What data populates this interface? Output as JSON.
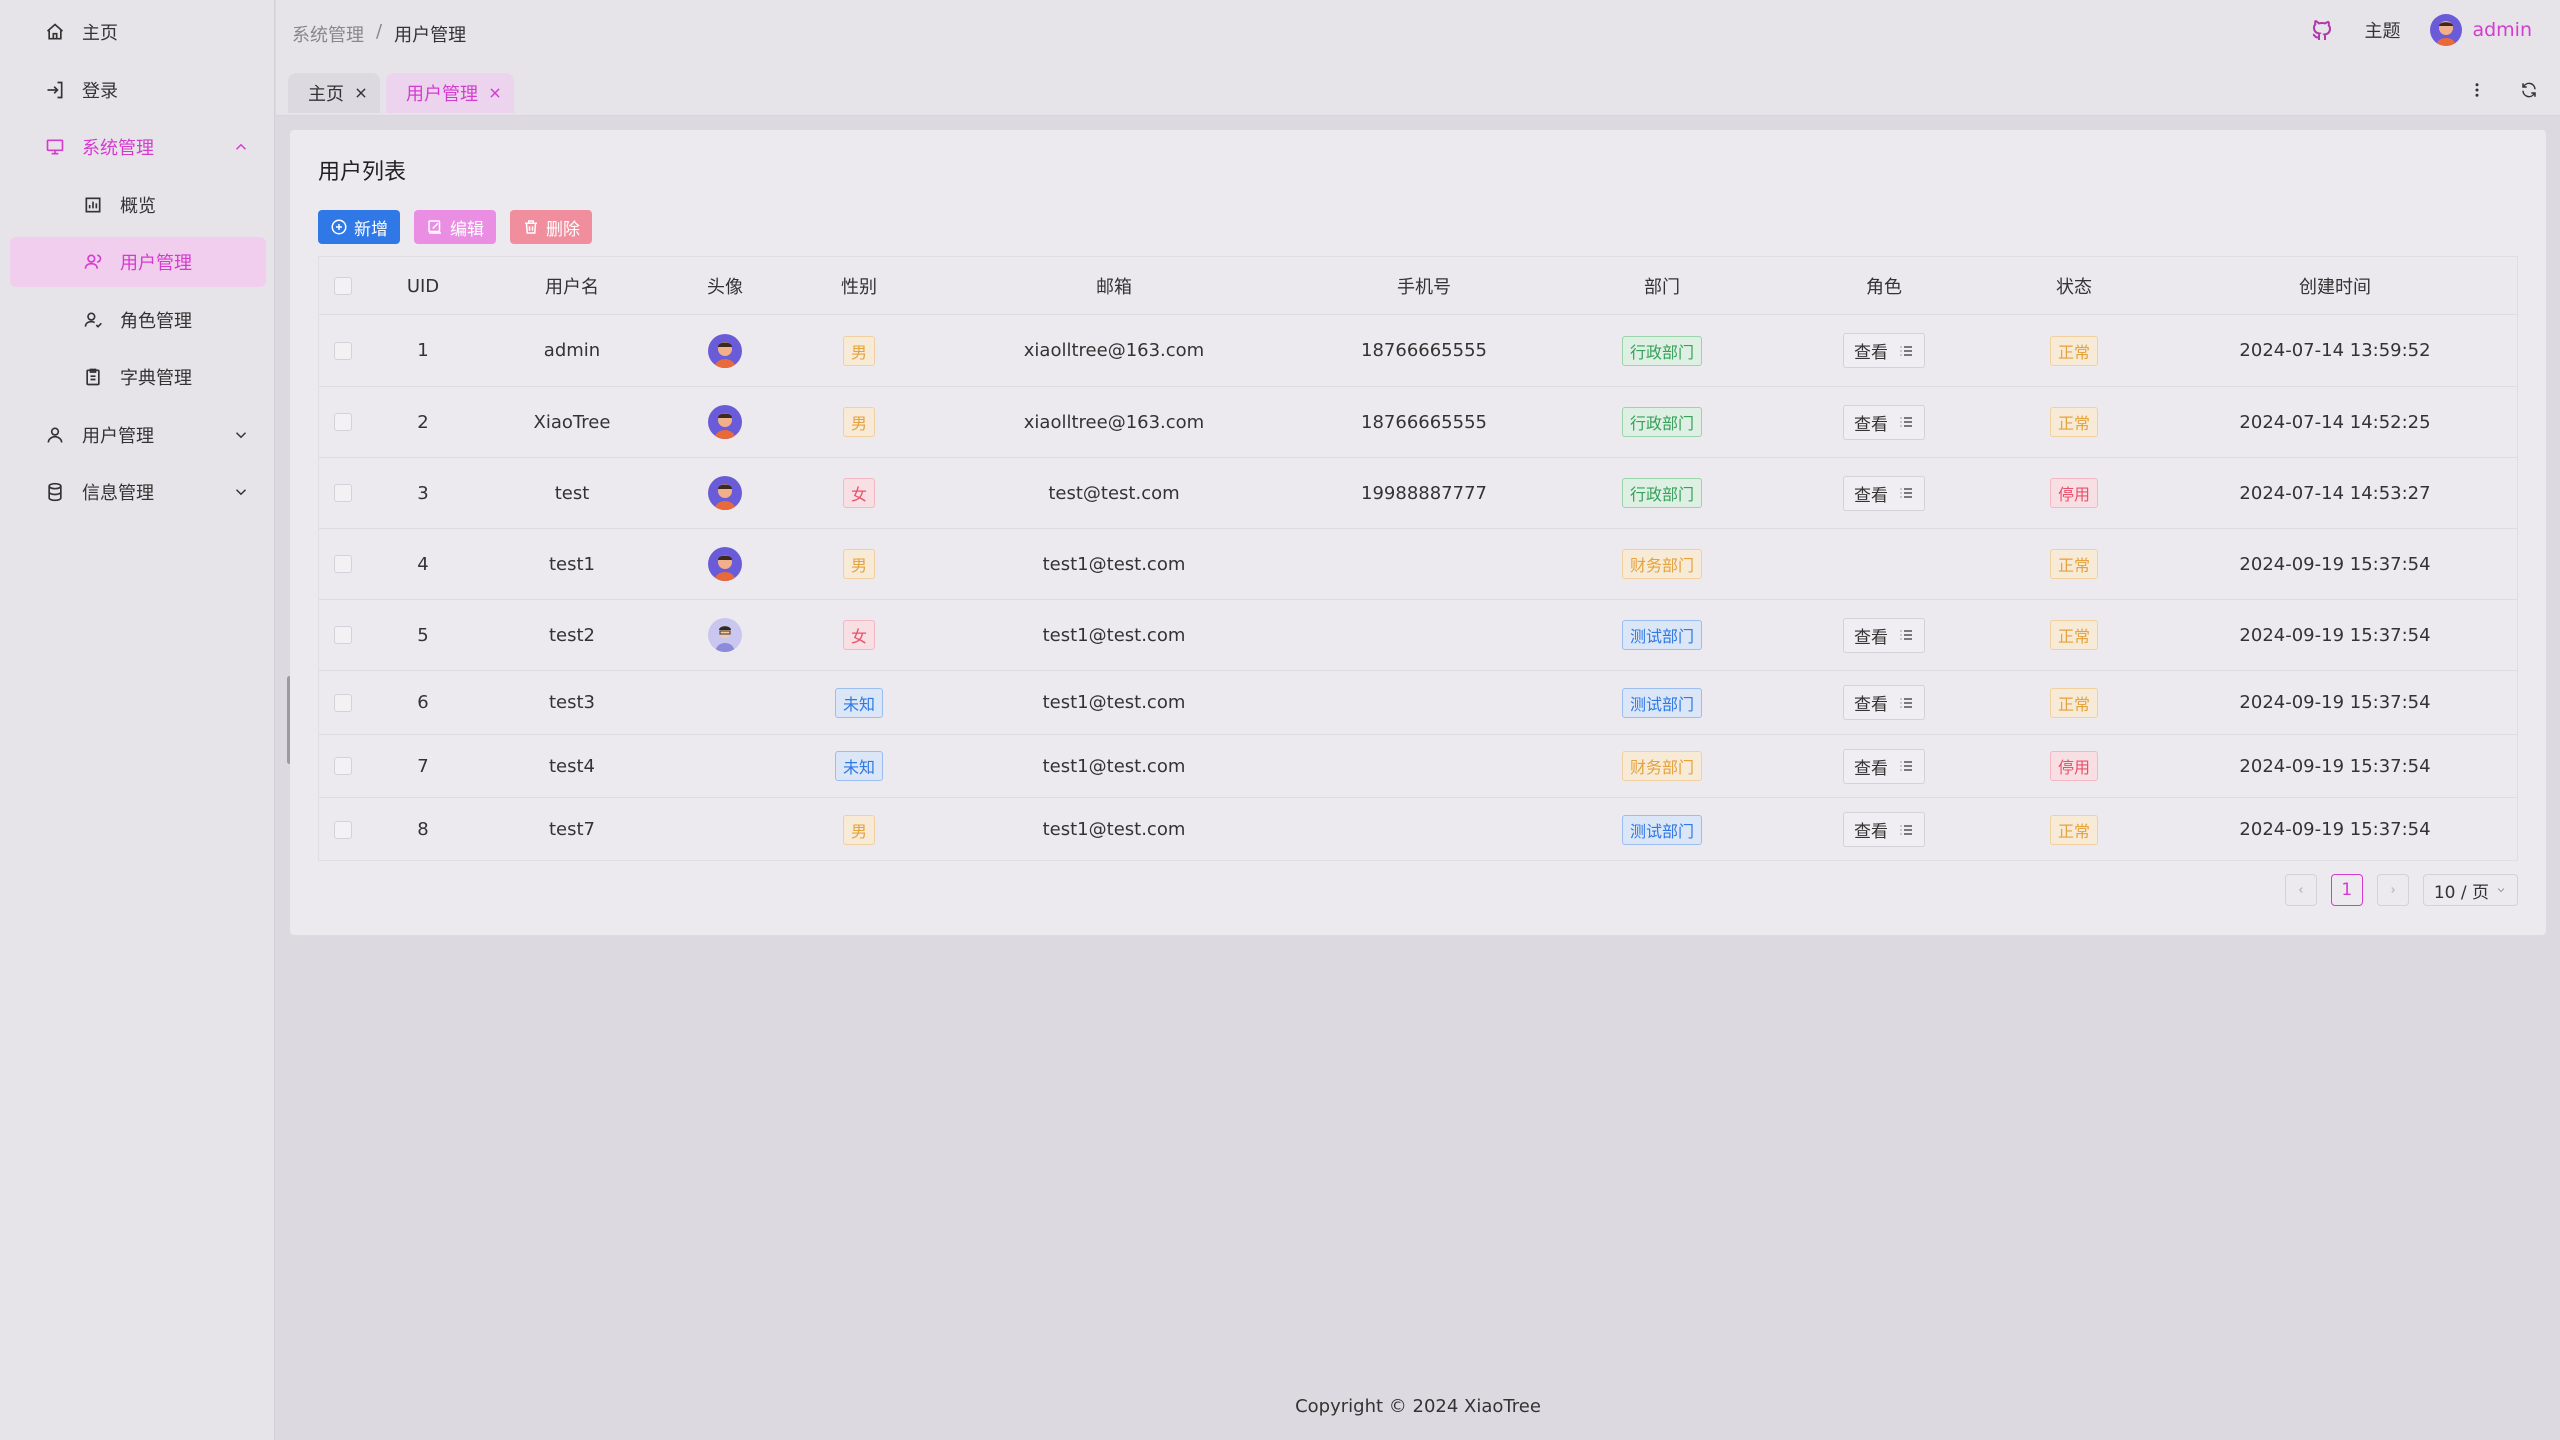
{
  "sidebar": {
    "items": [
      {
        "label": "主页"
      },
      {
        "label": "登录"
      },
      {
        "label": "系统管理"
      },
      {
        "label": "概览"
      },
      {
        "label": "用户管理"
      },
      {
        "label": "角色管理"
      },
      {
        "label": "字典管理"
      },
      {
        "label": "用户管理"
      },
      {
        "label": "信息管理"
      }
    ]
  },
  "header": {
    "breadcrumb": [
      "系统管理",
      "/",
      "用户管理"
    ],
    "theme_label": "主题",
    "username": "admin"
  },
  "tabs": [
    {
      "label": "主页"
    },
    {
      "label": "用户管理"
    }
  ],
  "card": {
    "title": "用户列表",
    "buttons": {
      "add": "新增",
      "edit": "编辑",
      "delete": "删除"
    }
  },
  "table": {
    "columns": [
      "UID",
      "用户名",
      "头像",
      "性别",
      "邮箱",
      "手机号",
      "部门",
      "角色",
      "状态",
      "创建时间"
    ],
    "role_button_label": "查看",
    "rows": [
      {
        "uid": "1",
        "username": "admin",
        "gender": "男",
        "email": "xiaolltree@163.com",
        "phone": "18766665555",
        "dept": "行政部门",
        "status": "正常",
        "created": "2024-07-14 13:59:52"
      },
      {
        "uid": "2",
        "username": "XiaoTree",
        "gender": "男",
        "email": "xiaolltree@163.com",
        "phone": "18766665555",
        "dept": "行政部门",
        "status": "正常",
        "created": "2024-07-14 14:52:25"
      },
      {
        "uid": "3",
        "username": "test",
        "gender": "女",
        "email": "test@test.com",
        "phone": "19988887777",
        "dept": "行政部门",
        "status": "停用",
        "created": "2024-07-14 14:53:27"
      },
      {
        "uid": "4",
        "username": "test1",
        "gender": "男",
        "email": "test1@test.com",
        "phone": "",
        "dept": "财务部门",
        "status": "正常",
        "created": "2024-09-19 15:37:54"
      },
      {
        "uid": "5",
        "username": "test2",
        "gender": "女",
        "email": "test1@test.com",
        "phone": "",
        "dept": "测试部门",
        "status": "正常",
        "created": "2024-09-19 15:37:54"
      },
      {
        "uid": "6",
        "username": "test3",
        "gender": "未知",
        "email": "test1@test.com",
        "phone": "",
        "dept": "测试部门",
        "status": "正常",
        "created": "2024-09-19 15:37:54"
      },
      {
        "uid": "7",
        "username": "test4",
        "gender": "未知",
        "email": "test1@test.com",
        "phone": "",
        "dept": "财务部门",
        "status": "停用",
        "created": "2024-09-19 15:37:54"
      },
      {
        "uid": "8",
        "username": "test7",
        "gender": "男",
        "email": "test1@test.com",
        "phone": "",
        "dept": "测试部门",
        "status": "正常",
        "created": "2024-09-19 15:37:54"
      }
    ]
  },
  "pagination": {
    "current_page": "1",
    "page_size": "10 / 页"
  },
  "footer": {
    "copyright": "Copyright © 2024 XiaoTree"
  },
  "colors": {
    "accent": "#d63bd0",
    "primary": "#2f78e5"
  }
}
